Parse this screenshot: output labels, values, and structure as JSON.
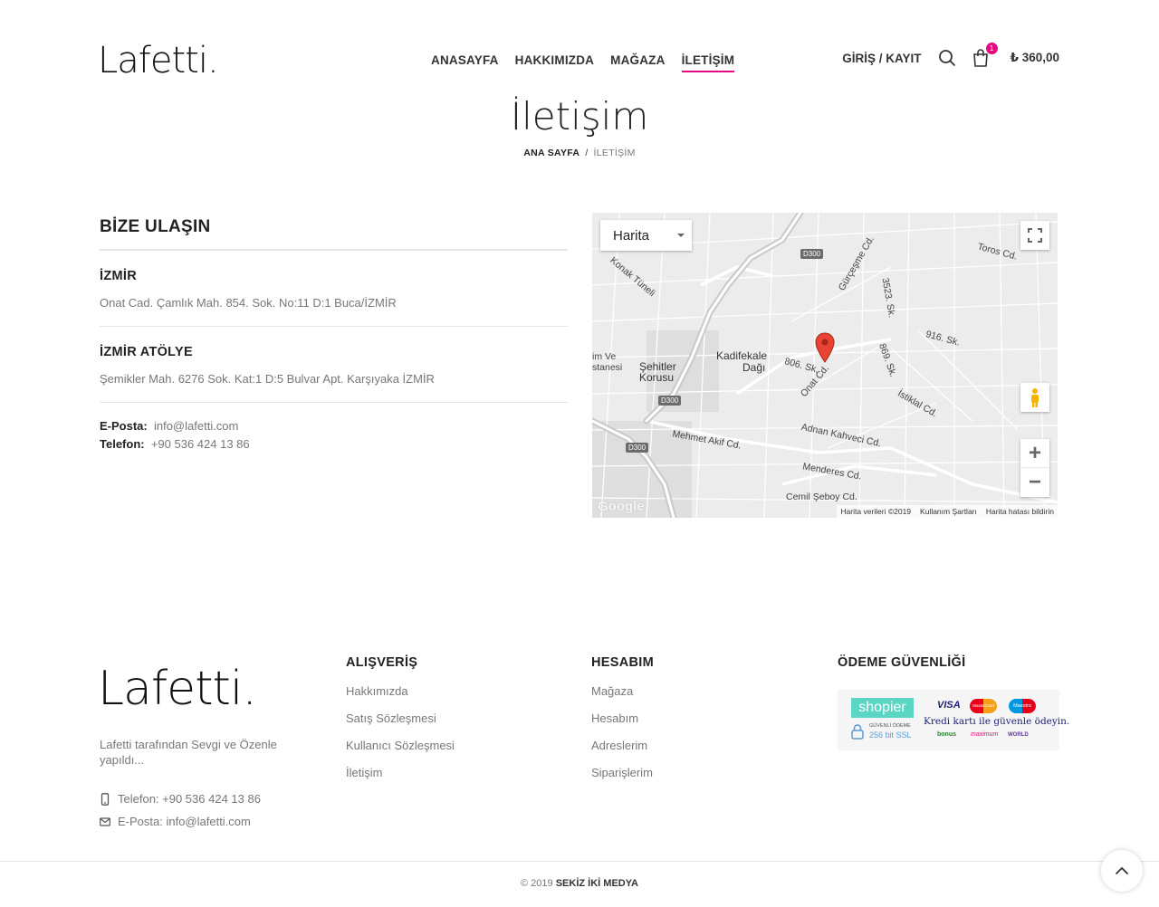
{
  "brand": {
    "logo": "Lafetti.",
    "accent": "#e5097f"
  },
  "nav": {
    "items": [
      {
        "label": "ANASAYFA"
      },
      {
        "label": "HAKKIMIZDA"
      },
      {
        "label": "MAĞAZA"
      },
      {
        "label": "İLETİŞİM"
      }
    ],
    "login": "GİRİŞ / KAYIT",
    "cart_count": "1",
    "cart_total": "₺ 360,00"
  },
  "page": {
    "title": "İletişim",
    "breadcrumb_home": "ANA SAYFA",
    "breadcrumb_sep": "/",
    "breadcrumb_current": "İLETİŞİM"
  },
  "contact": {
    "heading": "BİZE ULAŞIN",
    "locations": [
      {
        "name": "İZMİR",
        "address": "Onat Cad. Çamlık Mah. 854. Sok. No:11 D:1 Buca/İZMİR"
      },
      {
        "name": "İZMİR ATÖLYE",
        "address": "Şemikler Mah. 6276 Sok. Kat:1 D:5 Bulvar Apt. Karşıyaka İZMİR"
      }
    ],
    "email_label": "E-Posta:",
    "email": "info@lafetti.com",
    "phone_label": "Telefon:",
    "phone": "+90 536 424 13 86"
  },
  "map": {
    "type_label": "Harita",
    "labels": {
      "kadifekale": "Kadifekale",
      "dagi": "Dağı",
      "sehitler": "Şehitler",
      "korusu": "Korusu",
      "im_ve": "im Ve",
      "stanesi": "stanesi",
      "mehmet_akif": "Mehmet Akif Cd.",
      "adnan_kahveci": "Adnan Kahveci Cd.",
      "menderes": "Menderes Cd.",
      "cemil_seboy": "Cemil Şeboy Cd.",
      "istiklal": "İstiklal Cd.",
      "onat": "Onat Cd.",
      "sk806": "806. Sk.",
      "sk916": "916. Sk.",
      "toros": "Toros Cd.",
      "gurcesme": "Gürçeşme Cd.",
      "konak": "Konak Tüneli",
      "sk3523": "3523. Sk.",
      "sk869": "869. Sk."
    },
    "road_d300": "D300",
    "footer_data": "Harita verileri ©2019",
    "footer_terms": "Kullanım Şartları",
    "footer_report": "Harita hatası bildirin",
    "google": "Google"
  },
  "footer": {
    "about": "Lafetti tarafından Sevgi ve Özenle yapıldı...",
    "phone": "Telefon: +90 536 424 13 86",
    "email": "E-Posta: info@lafetti.com",
    "columns": [
      {
        "title": "ALIŞVERİŞ",
        "links": [
          "Hakkımızda",
          "Satış Sözleşmesi",
          "Kullanıcı Sözleşmesi",
          "İletişim"
        ]
      },
      {
        "title": "HESABIM",
        "links": [
          "Mağaza",
          "Hesabım",
          "Adreslerim",
          "Siparişlerim"
        ]
      },
      {
        "title": "ÖDEME GÜVENLİĞİ",
        "links": []
      }
    ],
    "security": {
      "shopier": "shopier",
      "secure_payment": "GÜVENLİ ÖDEME",
      "ssl": "256 bit SSL",
      "visa": "VISA",
      "mastercard": "MasterCard",
      "maestro": "Maestro",
      "tagline": "Kredi kartı ile güvenle ödeyin.",
      "bonus": "bonus",
      "maximum": "maximum",
      "world": "WORLD"
    },
    "copyright_year": "2019",
    "copyright_company": "SEKİZ İKİ MEDYA"
  }
}
